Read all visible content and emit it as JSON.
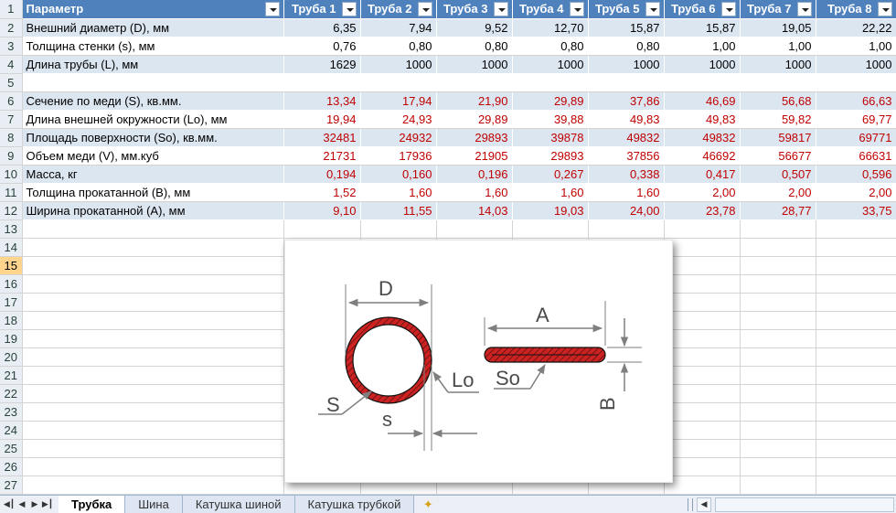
{
  "header": {
    "param": "Параметр",
    "cols": [
      "Труба 1",
      "Труба 2",
      "Труба 3",
      "Труба 4",
      "Труба 5",
      "Труба 6",
      "Труба 7",
      "Труба 8"
    ]
  },
  "rows": [
    {
      "num": "1"
    },
    {
      "num": "2",
      "label": "Внешний диаметр (D), мм",
      "values": [
        "6,35",
        "7,94",
        "9,52",
        "12,70",
        "15,87",
        "15,87",
        "19,05",
        "22,22"
      ],
      "style": "band",
      "color": "black"
    },
    {
      "num": "3",
      "label": "Толщина стенки (s), мм",
      "values": [
        "0,76",
        "0,80",
        "0,80",
        "0,80",
        "0,80",
        "1,00",
        "1,00",
        "1,00"
      ],
      "style": "plain",
      "color": "black"
    },
    {
      "num": "4",
      "label": "Длина трубы (L), мм",
      "values": [
        "1629",
        "1000",
        "1000",
        "1000",
        "1000",
        "1000",
        "1000",
        "1000"
      ],
      "style": "band",
      "color": "black"
    },
    {
      "num": "5",
      "label": "",
      "values": [
        "",
        "",
        "",
        "",
        "",
        "",
        "",
        ""
      ],
      "style": "plain",
      "color": "black"
    },
    {
      "num": "6",
      "label": "Сечение по меди (S), кв.мм.",
      "values": [
        "13,34",
        "17,94",
        "21,90",
        "29,89",
        "37,86",
        "46,69",
        "56,68",
        "66,63"
      ],
      "style": "band",
      "color": "red"
    },
    {
      "num": "7",
      "label": "Длина внешней окружности (Lo), мм",
      "values": [
        "19,94",
        "24,93",
        "29,89",
        "39,88",
        "49,83",
        "49,83",
        "59,82",
        "69,77"
      ],
      "style": "plain",
      "color": "red"
    },
    {
      "num": "8",
      "label": "Площадь поверхности (So), кв.мм.",
      "values": [
        "32481",
        "24932",
        "29893",
        "39878",
        "49832",
        "49832",
        "59817",
        "69771"
      ],
      "style": "band",
      "color": "red"
    },
    {
      "num": "9",
      "label": "Объем меди (V), мм.куб",
      "values": [
        "21731",
        "17936",
        "21905",
        "29893",
        "37856",
        "46692",
        "56677",
        "66631"
      ],
      "style": "plain",
      "color": "red"
    },
    {
      "num": "10",
      "label": "Масса, кг",
      "values": [
        "0,194",
        "0,160",
        "0,196",
        "0,267",
        "0,338",
        "0,417",
        "0,507",
        "0,596"
      ],
      "style": "band",
      "color": "red"
    },
    {
      "num": "11",
      "label": "Толщина прокатанной (В), мм",
      "values": [
        "1,52",
        "1,60",
        "1,60",
        "1,60",
        "1,60",
        "2,00",
        "2,00",
        "2,00"
      ],
      "style": "plain",
      "color": "red"
    },
    {
      "num": "12",
      "label": "Ширина прокатанной (А), мм",
      "values": [
        "9,10",
        "11,55",
        "14,03",
        "19,03",
        "24,00",
        "23,78",
        "28,77",
        "33,75"
      ],
      "style": "band",
      "color": "red"
    }
  ],
  "empty_rows": [
    "13",
    "14",
    "15",
    "16",
    "17",
    "18",
    "19",
    "20",
    "21",
    "22",
    "23",
    "24",
    "25",
    "26",
    "27"
  ],
  "selected_row": "15",
  "drawing": {
    "labels": {
      "D": "D",
      "A": "A",
      "S": "S",
      "s": "s",
      "Lo": "Lo",
      "So": "So",
      "B": "B"
    },
    "colors": {
      "copper": "#cc2222",
      "arrow": "#7f7f7f",
      "text": "#4b4b4b"
    }
  },
  "tabs": [
    "Трубка",
    "Шина",
    "Катушка шиной",
    "Катушка трубкой"
  ],
  "active_tab": "Трубка",
  "icons": {
    "nav": [
      "first-sheet-icon",
      "prev-sheet-icon",
      "next-sheet-icon",
      "last-sheet-icon"
    ],
    "new_sheet": "new-sheet-icon"
  },
  "theme": {
    "header_blue": "#4f81bd",
    "band_blue": "#dce6f1",
    "red_text": "#c00000"
  }
}
